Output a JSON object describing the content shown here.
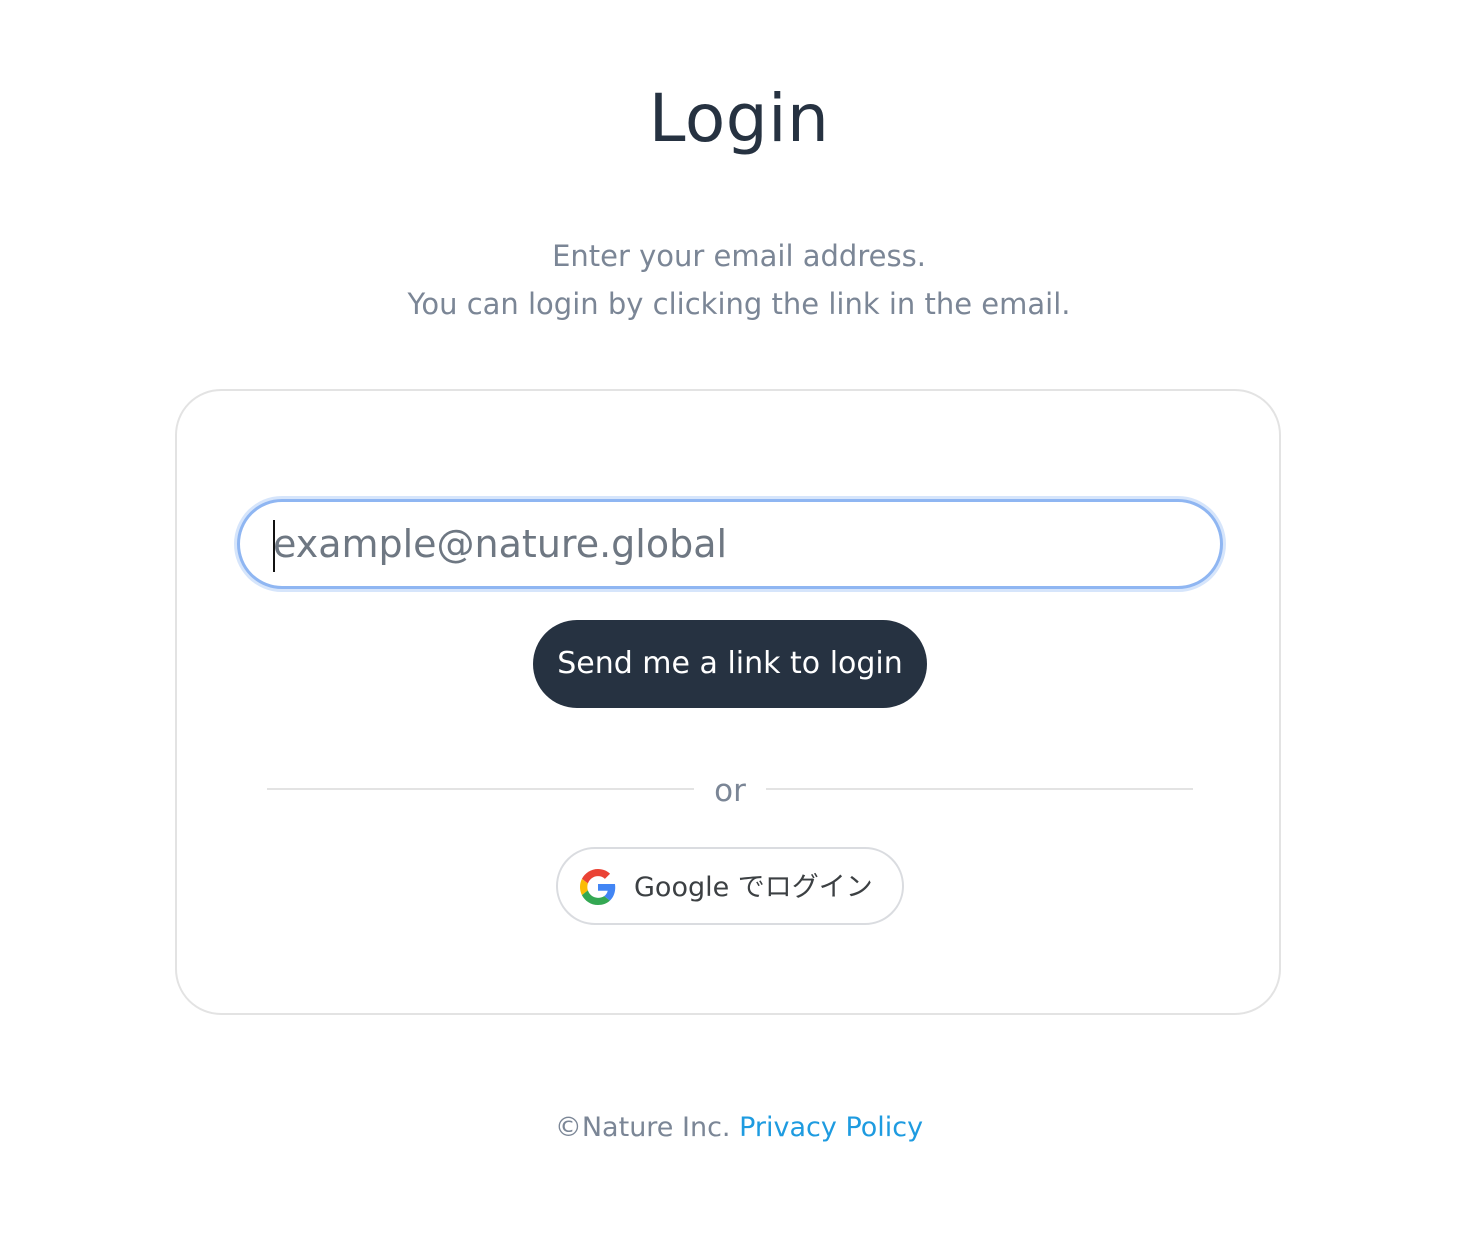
{
  "page": {
    "title": "Login",
    "subtitle_line1": "Enter your email address.",
    "subtitle_line2": "You can login by clicking the link in the email."
  },
  "form": {
    "email_placeholder": "example@nature.global",
    "email_value": "",
    "send_button_label": "Send me a link to login",
    "divider_text": "or",
    "google_button_label": "Google でログイン",
    "google_icon": "google-g-icon"
  },
  "footer": {
    "copyright": "©Nature Inc.",
    "privacy_link": "Privacy Policy"
  },
  "colors": {
    "primary_dark": "#263241",
    "muted_text": "#7b8696",
    "link": "#1e9be0",
    "focus_ring": "#8fb6f2",
    "card_border": "#e3e3e3"
  }
}
